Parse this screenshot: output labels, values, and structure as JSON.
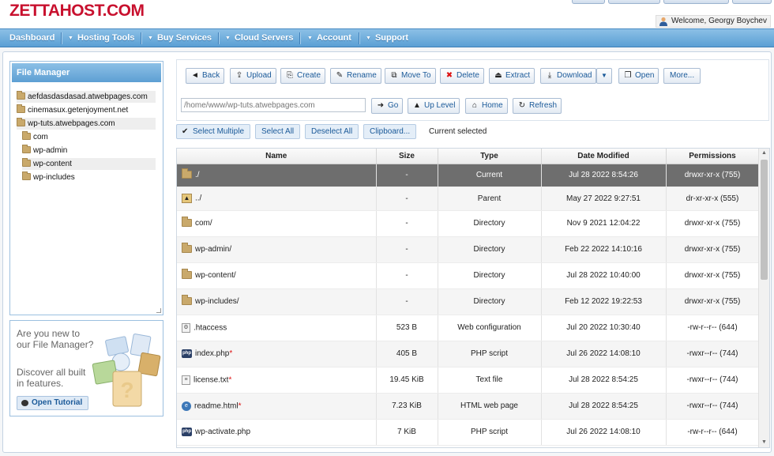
{
  "brand": {
    "logo": "ZETTAHOST.COM"
  },
  "user": {
    "welcome": "Welcome, Georgy Boychev"
  },
  "nav": [
    {
      "label": "Dashboard",
      "arrow": ""
    },
    {
      "label": "Hosting Tools",
      "arrow": "▼"
    },
    {
      "label": "Buy Services",
      "arrow": "▼"
    },
    {
      "label": "Cloud Servers",
      "arrow": "▼"
    },
    {
      "label": "Account",
      "arrow": "▼"
    },
    {
      "label": "Support",
      "arrow": "▼"
    }
  ],
  "sidebar": {
    "title": "File Manager",
    "tree": [
      {
        "label": "aefdasdasdasad.atwebpages.com",
        "depth": 0,
        "highlight": true
      },
      {
        "label": "cinemasux.getenjoyment.net",
        "depth": 0,
        "highlight": false
      },
      {
        "label": "wp-tuts.atwebpages.com",
        "depth": 0,
        "highlight": true
      },
      {
        "label": "com",
        "depth": 1,
        "highlight": false
      },
      {
        "label": "wp-admin",
        "depth": 1,
        "highlight": false
      },
      {
        "label": "wp-content",
        "depth": 1,
        "highlight": true
      },
      {
        "label": "wp-includes",
        "depth": 1,
        "highlight": false
      }
    ]
  },
  "tutorial": {
    "line1": "Are you new to our File Manager?",
    "line2": "Discover all built in features.",
    "button": "Open Tutorial"
  },
  "toolbar": {
    "back": "Back",
    "upload": "Upload",
    "create": "Create",
    "rename": "Rename",
    "move_to": "Move To",
    "delete": "Delete",
    "extract": "Extract",
    "download": "Download",
    "open": "Open",
    "more": "More..."
  },
  "pathbar": {
    "path": "/home/www/wp-tuts.atwebpages.com",
    "go": "Go",
    "up_level": "Up Level",
    "home": "Home",
    "refresh": "Refresh"
  },
  "selection": {
    "select_multiple": "Select Multiple",
    "select_all": "Select All",
    "deselect_all": "Deselect All",
    "clipboard": "Clipboard...",
    "current_selected": "Current selected"
  },
  "table": {
    "columns": [
      "Name",
      "Size",
      "Type",
      "Date Modified",
      "Permissions"
    ],
    "rows": [
      {
        "icon": "folder-icon",
        "name": "./",
        "modified": false,
        "size": "-",
        "type": "Current",
        "date": "Jul 28 2022 8:54:26",
        "perms": "drwxr-xr-x (755)"
      },
      {
        "icon": "parent-folder-icon",
        "name": "../",
        "modified": false,
        "size": "-",
        "type": "Parent",
        "date": "May 27 2022 9:27:51",
        "perms": "dr-xr-xr-x (555)"
      },
      {
        "icon": "folder-icon",
        "name": "com/",
        "modified": false,
        "size": "-",
        "type": "Directory",
        "date": "Nov 9 2021 12:04:22",
        "perms": "drwxr-xr-x (755)"
      },
      {
        "icon": "folder-icon",
        "name": "wp-admin/",
        "modified": false,
        "size": "-",
        "type": "Directory",
        "date": "Feb 22 2022 14:10:16",
        "perms": "drwxr-xr-x (755)"
      },
      {
        "icon": "folder-icon",
        "name": "wp-content/",
        "modified": false,
        "size": "-",
        "type": "Directory",
        "date": "Jul 28 2022 10:40:00",
        "perms": "drwxr-xr-x (755)"
      },
      {
        "icon": "folder-icon",
        "name": "wp-includes/",
        "modified": false,
        "size": "-",
        "type": "Directory",
        "date": "Feb 12 2022 19:22:53",
        "perms": "drwxr-xr-x (755)"
      },
      {
        "icon": "config-file-icon",
        "name": ".htaccess",
        "modified": false,
        "size": "523 B",
        "type": "Web configuration",
        "date": "Jul 20 2022 10:30:40",
        "perms": "-rw-r--r-- (644)"
      },
      {
        "icon": "php-file-icon",
        "name": "index.php",
        "modified": true,
        "size": "405 B",
        "type": "PHP script",
        "date": "Jul 26 2022 14:08:10",
        "perms": "-rwxr--r-- (744)"
      },
      {
        "icon": "text-file-icon",
        "name": "license.txt",
        "modified": true,
        "size": "19.45 KiB",
        "type": "Text file",
        "date": "Jul 28 2022 8:54:25",
        "perms": "-rwxr--r-- (744)"
      },
      {
        "icon": "html-file-icon",
        "name": "readme.html",
        "modified": true,
        "size": "7.23 KiB",
        "type": "HTML web page",
        "date": "Jul 28 2022 8:54:25",
        "perms": "-rwxr--r-- (744)"
      },
      {
        "icon": "php-file-icon",
        "name": "wp-activate.php",
        "modified": false,
        "size": "7 KiB",
        "type": "PHP script",
        "date": "Jul 26 2022 14:08:10",
        "perms": "-rw-r--r-- (644)"
      }
    ]
  },
  "colors": {
    "brand_red": "#c8102e",
    "nav_blue": "#5a9fd4",
    "selected_row": "#6e6e6e",
    "link_blue": "#1b5a99"
  }
}
